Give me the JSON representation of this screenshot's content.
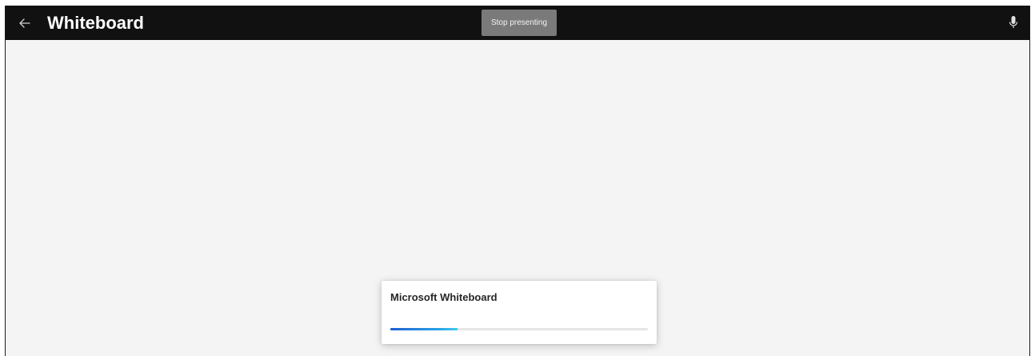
{
  "header": {
    "title": "Whiteboard",
    "back_icon": "arrow-left-icon",
    "mic_icon": "microphone-icon"
  },
  "presenting": {
    "stop_label": "Stop presenting"
  },
  "loading_toast": {
    "title": "Microsoft Whiteboard",
    "progress": 0.26
  },
  "colors": {
    "topbar": "#111111",
    "canvas": "#f4f4f4",
    "stop_button": "#7a7a7a",
    "progress_start": "#1f5fd1",
    "progress_end": "#40c8e8"
  }
}
